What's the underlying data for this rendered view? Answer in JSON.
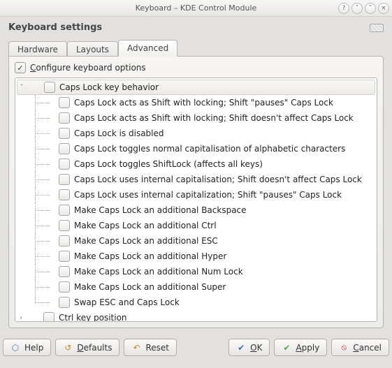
{
  "window": {
    "title": "Keyboard – KDE Control Module"
  },
  "header": {
    "title": "Keyboard settings"
  },
  "tabs": {
    "hardware": "Hardware",
    "layouts": "Layouts",
    "advanced": "Advanced",
    "active": "advanced"
  },
  "advancedPanel": {
    "configure_prefix": "C",
    "configure_suffix": "onfigure keyboard options",
    "configure_checked": true
  },
  "tree": {
    "capsGroup": "Caps Lock key behavior",
    "capsItems": [
      "Caps Lock acts as Shift with locking; Shift \"pauses\" Caps Lock",
      "Caps Lock acts as Shift with locking; Shift doesn't affect Caps Lock",
      "Caps Lock is disabled",
      "Caps Lock toggles normal capitalisation of alphabetic characters",
      "Caps Lock toggles ShiftLock (affects all keys)",
      "Caps Lock uses internal capitalisation; Shift doesn't affect Caps Lock",
      "Caps Lock uses internal capitalization; Shift \"pauses\" Caps Lock",
      "Make Caps Lock an additional Backspace",
      "Make Caps Lock an additional Ctrl",
      "Make Caps Lock an additional ESC",
      "Make Caps Lock an additional Hyper",
      "Make Caps Lock an additional Num Lock",
      "Make Caps Lock an additional Super",
      "Swap ESC and Caps Lock"
    ],
    "ctrlGroup": "Ctrl key position"
  },
  "buttons": {
    "help": "Help",
    "defaults_prefix": "D",
    "defaults_suffix": "efaults",
    "reset": "Reset",
    "ok_prefix": "O",
    "ok_suffix": "K",
    "apply_prefix": "A",
    "apply_suffix": "pply",
    "cancel_prefix": "C",
    "cancel_suffix": "ancel"
  },
  "icons": {
    "whatsthis": "?",
    "minimize": "˅",
    "maximize": "˄",
    "close": "×",
    "help": "⬡",
    "defaults": "↺",
    "reset": "↶",
    "ok": "✔",
    "apply": "✔",
    "cancel": "⦸",
    "expanded": "˅",
    "collapsed": "›"
  },
  "colors": {
    "ok": "#3a6fb0",
    "apply": "#52a749",
    "cancel": "#c0392b",
    "defaults": "#c28b2a",
    "reset": "#c28b2a",
    "help": "#4a7ab5"
  }
}
